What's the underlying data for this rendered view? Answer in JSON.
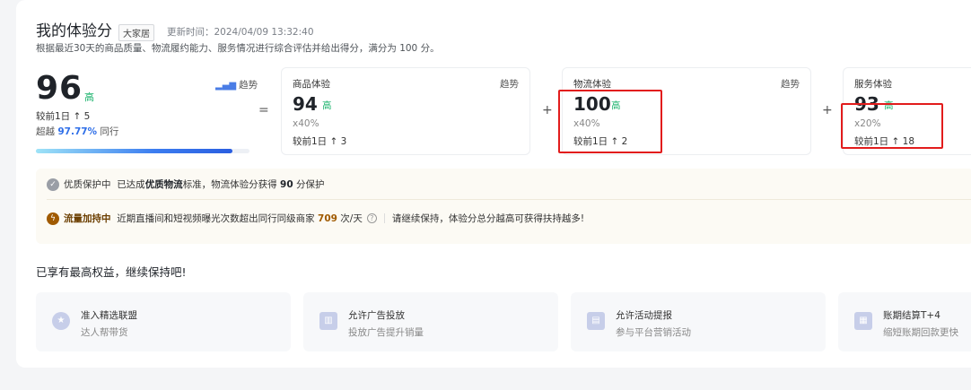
{
  "header": {
    "title": "我的体验分",
    "tag": "大家居",
    "updated": "更新时间：2024/04/09 13:32:40",
    "description": "根据最近30天的商品质量、物流履约能力、服务情况进行综合评估并给出得分，满分为 100 分。"
  },
  "total": {
    "score": "96",
    "level": "高",
    "trend_label": "趋势",
    "compare": "较前1日 ↑ 5",
    "beat_prefix": "超越",
    "beat_pct": "97.77%",
    "beat_suffix": "同行",
    "progress_fraction": 0.92
  },
  "operators": {
    "equals": "=",
    "plus": "+"
  },
  "metrics": [
    {
      "name": "商品体验",
      "trend": "趋势",
      "score": "94",
      "level": "高",
      "weight": "x40%",
      "compare": "较前1日 ↑ 3"
    },
    {
      "name": "物流体验",
      "trend": "趋势",
      "score": "100",
      "level": "高",
      "weight": "x40%",
      "compare": "较前1日 ↑ 2"
    },
    {
      "name": "服务体验",
      "trend": "",
      "score": "93",
      "level": "高",
      "weight": "x20%",
      "compare": "较前1日 ↑ 18"
    }
  ],
  "notices": {
    "quality": {
      "badge": "优质保护中",
      "text1": "已达成",
      "strong": "优质物流",
      "text2": "标准，物流体验分获得",
      "score": "90",
      "text3": "分保护"
    },
    "traffic": {
      "badge": "流量加持中",
      "text1": "近期直播间和短视频曝光次数超出同行同级商家",
      "count": "709",
      "text2": "次/天",
      "help_icon": "?",
      "text3": "请继续保持，体验分总分越高可获得扶持越多!"
    }
  },
  "perks": {
    "title": "已享有最高权益，继续保持吧!",
    "items": [
      {
        "name": "准入精选联盟",
        "desc": "达人帮带货"
      },
      {
        "name": "允许广告投放",
        "desc": "投放广告提升销量"
      },
      {
        "name": "允许活动提报",
        "desc": "参与平台营销活动"
      },
      {
        "name": "账期结算T+4",
        "desc": "缩短账期回款更快"
      }
    ]
  },
  "colors": {
    "accent": "#2f6fe8",
    "level_green": "#19b36b",
    "highlight_red": "#e21c1c",
    "shield": "#9a9ea6",
    "bolt": "#a05a00"
  }
}
